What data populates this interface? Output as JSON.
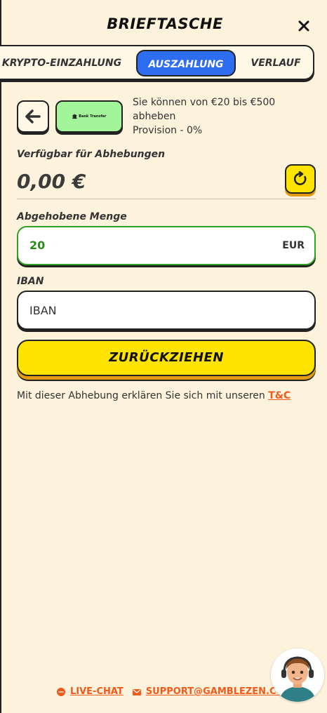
{
  "header": {
    "title": "BRIEFTASCHE",
    "close_icon": "close-icon"
  },
  "tabs": [
    {
      "label": "KRYPTO-EINZAHLUNG",
      "active": false
    },
    {
      "label": "AUSZAHLUNG",
      "active": true
    },
    {
      "label": "VERLAUF",
      "active": false
    }
  ],
  "method": {
    "back_icon": "arrow-left-icon",
    "card_label": "Bank Transfer",
    "info_line1": "Sie können von €20 bis €500",
    "info_line2": "abheben",
    "info_line3": "Provision - 0%"
  },
  "available": {
    "label": "Verfügbar für Abhebungen",
    "balance": "0,00 €",
    "refresh_icon": "refresh-icon"
  },
  "amount": {
    "label": "Abgehobene Menge",
    "value": "20",
    "currency": "EUR"
  },
  "iban": {
    "label": "IBAN",
    "placeholder": "IBAN"
  },
  "submit": {
    "label": "ZURÜCKZIEHEN"
  },
  "terms": {
    "text": "Mit dieser Abhebung erklären Sie sich mit unseren ",
    "link": "T&C"
  },
  "footer": {
    "live_chat": "LIVE-CHAT",
    "support": "SUPPORT@GAMBLEZEN.COM"
  },
  "colors": {
    "background": "#fdf3dc",
    "accent_blue": "#2f6df0",
    "accent_yellow": "#ffe400",
    "accent_green": "#2ea023",
    "link_orange": "#f25a1a"
  }
}
